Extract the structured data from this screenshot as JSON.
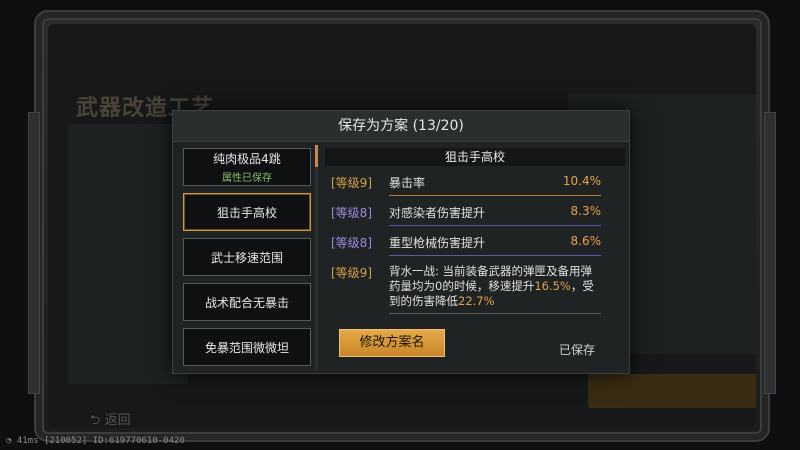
{
  "background": {
    "title": "武器改造工艺",
    "back_label": "返回"
  },
  "status_bar": {
    "ping": "41ms",
    "user_id": "[210052] ID:619770610-0420"
  },
  "modal": {
    "title": "保存为方案 (13/20)",
    "schemes": [
      {
        "name": "纯肉极品4跳",
        "sub": "属性已保存"
      },
      {
        "name": "狙击手高校",
        "sub": ""
      },
      {
        "name": "武士移速范围",
        "sub": ""
      },
      {
        "name": "战术配合无暴击",
        "sub": ""
      },
      {
        "name": "免暴范围微微坦",
        "sub": ""
      }
    ],
    "selected_index": 1,
    "detail": {
      "title": "狙击手高校",
      "attributes": [
        {
          "level": "[等级9]",
          "tier": "gold",
          "name": "暴击率",
          "value": "10.4%"
        },
        {
          "level": "[等级8]",
          "tier": "purple",
          "name": "对感染者伤害提升",
          "value": "8.3%"
        },
        {
          "level": "[等级8]",
          "tier": "purple",
          "name": "重型枪械伤害提升",
          "value": "8.6%"
        }
      ],
      "special": {
        "level": "[等级9]",
        "text_1": "背水一战: 当前装备武器的弹匣及备用弹药量均为0的时候，移速提升",
        "value_1": "16.5%",
        "text_2": "，受到的伤害降低",
        "value_2": "22.7%"
      }
    },
    "rename_button": "修改方案名",
    "saved_label": "已保存"
  },
  "colors": {
    "accent": "#e2a24c",
    "tier_gold": "#d6a048",
    "tier_purple": "#9b8ce0",
    "saved_green": "#86c06a"
  }
}
